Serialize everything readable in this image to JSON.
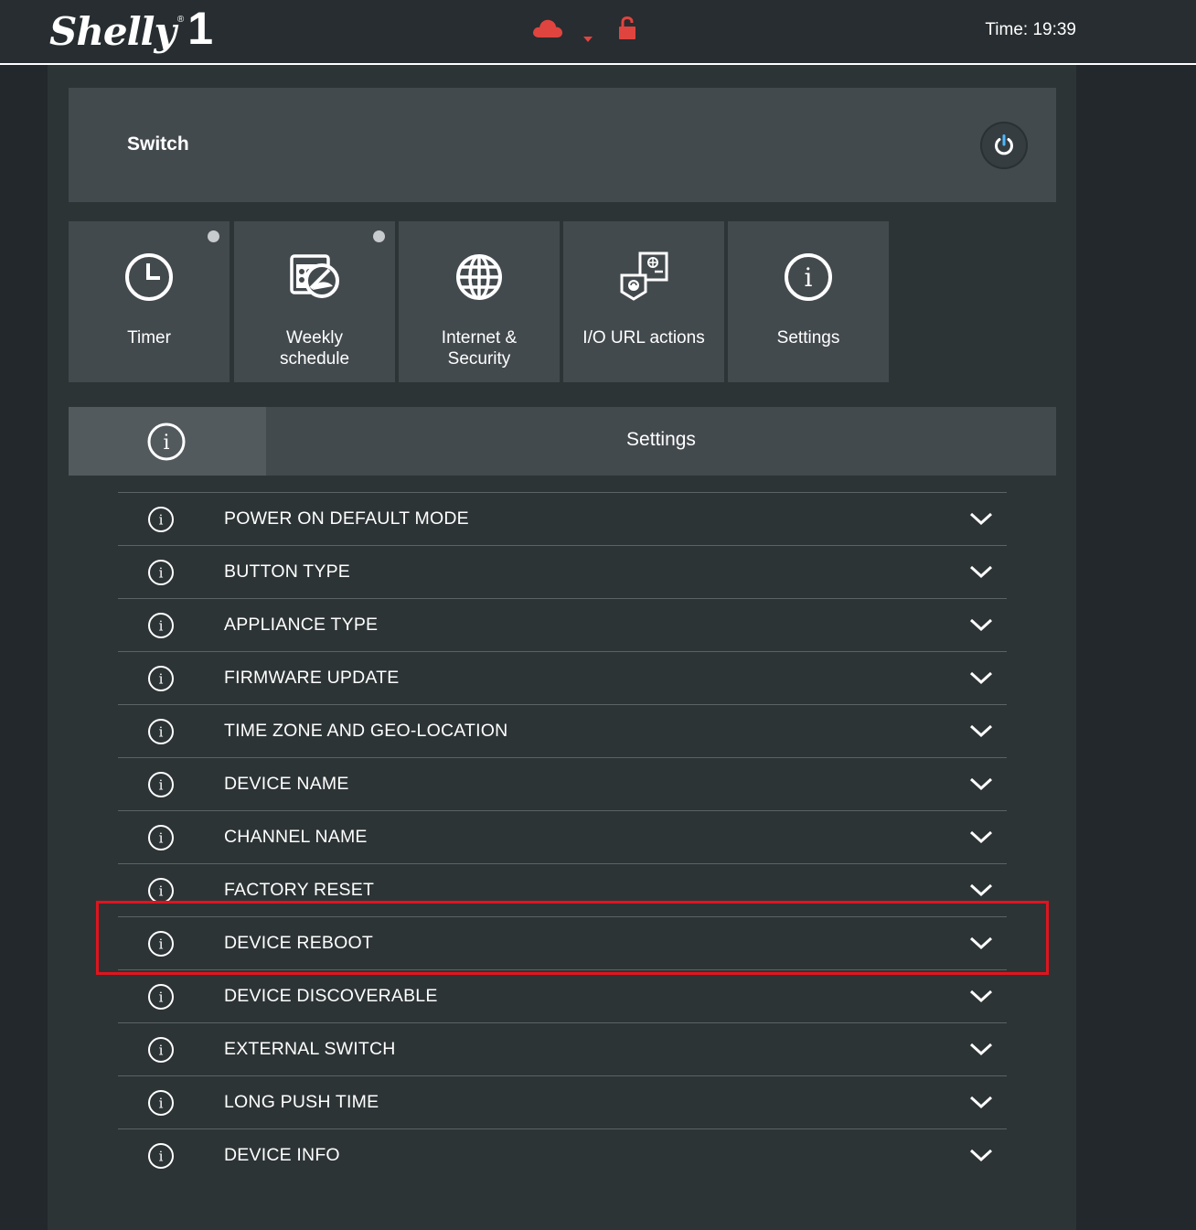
{
  "header": {
    "logo_text": "Shelly",
    "logo_registered": "®",
    "logo_model": "1",
    "status_icons": [
      "cloud-icon",
      "wifi-icon",
      "unlock-icon"
    ],
    "status_color": "#e0443f",
    "time_text": "Time: 19:39"
  },
  "switch": {
    "title": "Switch",
    "power_icon_color": "#4db8ff"
  },
  "tiles": [
    {
      "label": "Timer",
      "icon": "clock-icon",
      "has_dot": true
    },
    {
      "label": "Weekly\nschedule",
      "icon": "calendar-icon",
      "has_dot": true
    },
    {
      "label": "Internet &\nSecurity",
      "icon": "globe-icon",
      "has_dot": false
    },
    {
      "label": "I/O URL actions",
      "icon": "url-actions-icon",
      "has_dot": false
    },
    {
      "label": "Settings",
      "icon": "info-icon",
      "has_dot": false
    }
  ],
  "settings_header": {
    "title": "Settings"
  },
  "settings_items": [
    "POWER ON DEFAULT MODE",
    "BUTTON TYPE",
    "APPLIANCE TYPE",
    "FIRMWARE UPDATE",
    "TIME ZONE AND GEO-LOCATION",
    "DEVICE NAME",
    "CHANNEL NAME",
    "FACTORY RESET",
    "DEVICE REBOOT",
    "DEVICE DISCOVERABLE",
    "EXTERNAL SWITCH",
    "LONG PUSH TIME",
    "DEVICE INFO"
  ],
  "highlighted_item": "DEVICE REBOOT",
  "highlight_color": "#e0141e"
}
